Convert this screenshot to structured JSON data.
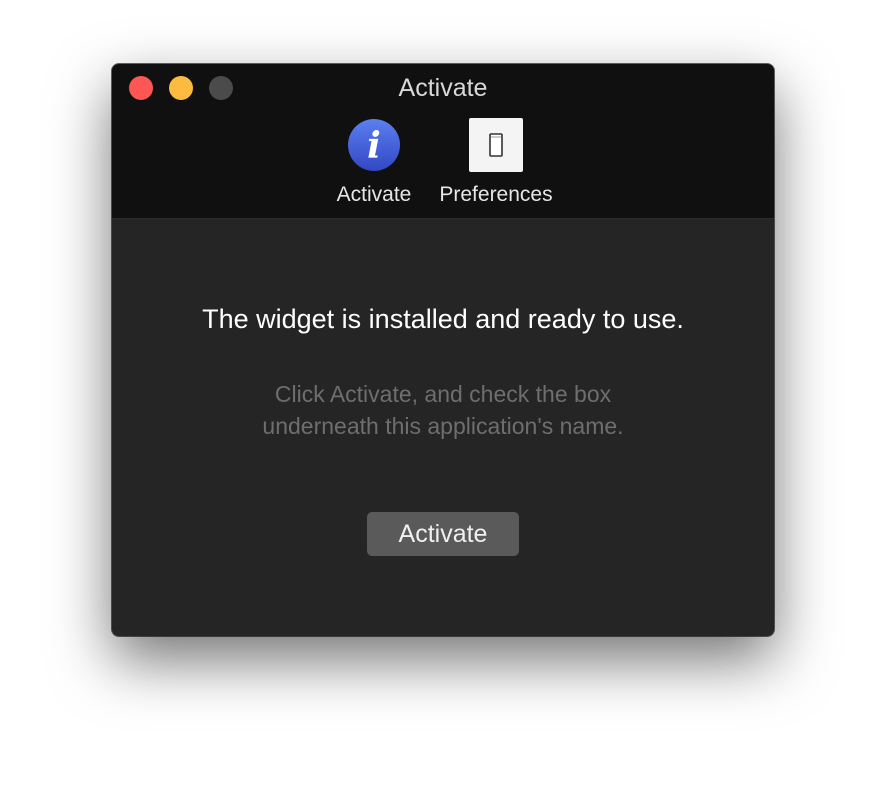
{
  "window": {
    "title": "Activate"
  },
  "toolbar": {
    "items": [
      {
        "label": "Activate",
        "icon": "info-icon",
        "selected": true
      },
      {
        "label": "Preferences",
        "icon": "light-switch-icon",
        "selected": false
      }
    ]
  },
  "content": {
    "headline": "The widget is installed and ready to use.",
    "instructions": "Click Activate, and check the box underneath this application's name.",
    "button_label": "Activate"
  },
  "colors": {
    "close": "#fc5753",
    "minimize": "#fdbc40",
    "zoom": "#4b4b4b",
    "info_icon_blue": "#3d5bd1"
  }
}
